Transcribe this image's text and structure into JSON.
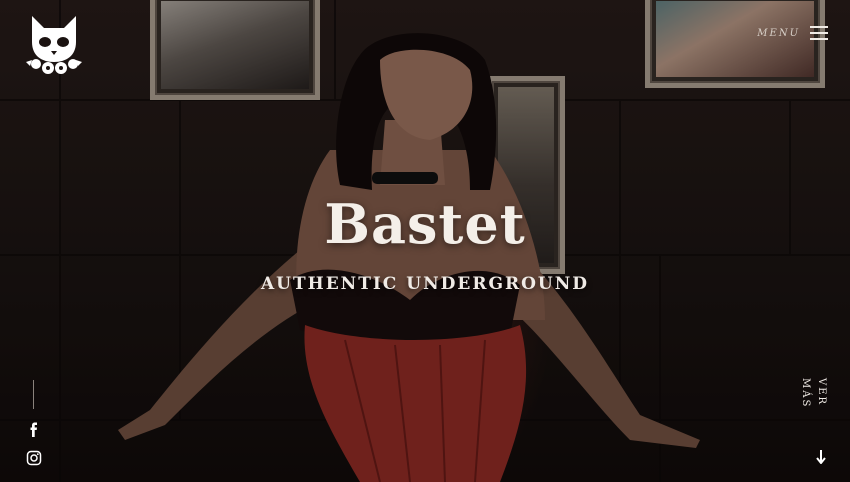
{
  "brand": {
    "logo_icon": "cat-skull-roses-logo-icon"
  },
  "nav": {
    "menu_label": "MENU",
    "menu_icon": "hamburger-icon"
  },
  "hero": {
    "title": "Bastet",
    "subtitle": "AUTHENTIC UNDERGROUND"
  },
  "social": [
    {
      "icon": "facebook-icon"
    },
    {
      "icon": "instagram-icon"
    }
  ],
  "scroll": {
    "label": "VER MÁS",
    "icon": "arrow-down-icon"
  },
  "colors": {
    "text": "#f0ebe6",
    "overlay": "#000000",
    "accent": "#8c2a24"
  }
}
